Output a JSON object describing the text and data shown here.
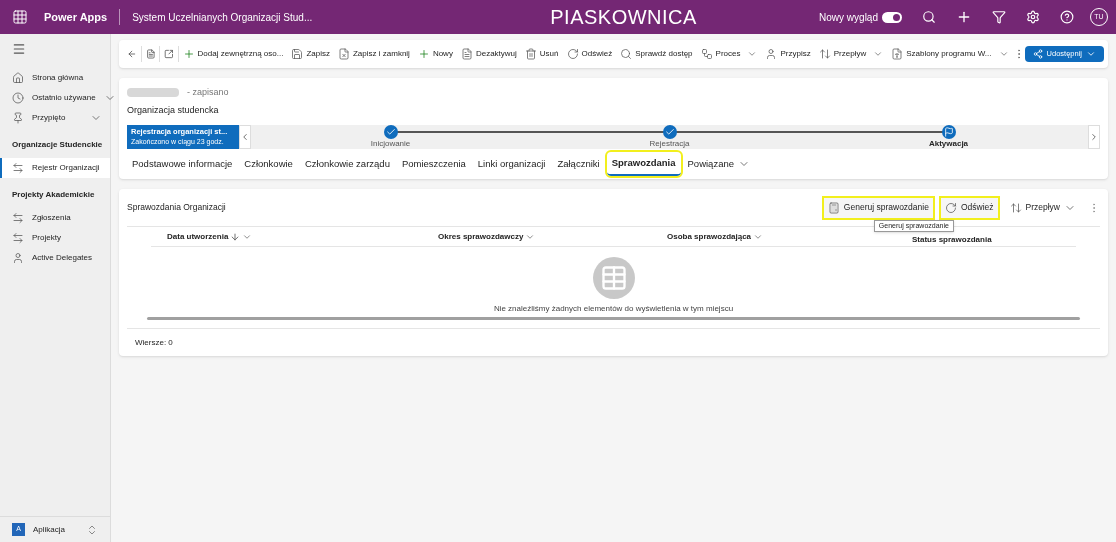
{
  "topbar": {
    "app": "Power Apps",
    "title": "System Uczelnianych Organizacji Stud...",
    "environment": "PIASKOWNICA",
    "new_look_label": "Nowy wygląd",
    "new_look_on": true,
    "avatar": "TU"
  },
  "sidebar": {
    "items": [
      {
        "kind": "item",
        "label": "Strona główna",
        "expandable": false,
        "selected": false
      },
      {
        "kind": "item",
        "label": "Ostatnio używane",
        "expandable": true,
        "selected": false
      },
      {
        "kind": "item",
        "label": "Przypięto",
        "expandable": true,
        "selected": false
      },
      {
        "kind": "group",
        "label": "Organizacje Studenckie"
      },
      {
        "kind": "item",
        "label": "Rejestr Organizacji",
        "expandable": false,
        "selected": true
      },
      {
        "kind": "group",
        "label": "Projekty Akademickie"
      },
      {
        "kind": "item",
        "label": "Zgłoszenia",
        "expandable": false,
        "selected": false
      },
      {
        "kind": "item",
        "label": "Projekty",
        "expandable": false,
        "selected": false
      },
      {
        "kind": "item",
        "label": "Active Delegates",
        "expandable": false,
        "selected": false
      }
    ],
    "area": {
      "badge": "A",
      "label": "Aplikacja"
    }
  },
  "commands": [
    {
      "label": "Dodaj zewnętrzną oso...",
      "dropdown": false
    },
    {
      "label": "Zapisz",
      "dropdown": false
    },
    {
      "label": "Zapisz i zamknij",
      "dropdown": false
    },
    {
      "label": "Nowy",
      "dropdown": false
    },
    {
      "label": "Dezaktywuj",
      "dropdown": false
    },
    {
      "label": "Usuń",
      "dropdown": false
    },
    {
      "label": "Odśwież",
      "dropdown": false
    },
    {
      "label": "Sprawdź dostęp",
      "dropdown": false
    },
    {
      "label": "Proces",
      "dropdown": true
    },
    {
      "label": "Przypisz",
      "dropdown": false
    },
    {
      "label": "Przepływ",
      "dropdown": true
    },
    {
      "label": "Szablony programu W...",
      "dropdown": true
    }
  ],
  "share_button": "Udostępnij",
  "record": {
    "status": "- zapisano",
    "entity": "Organizacja studencka"
  },
  "process": {
    "name": "Rejestracja organizacji st...",
    "duration": "Zakończono w ciągu 23 godz.",
    "stages": [
      {
        "label": "Inicjowanie",
        "done": true,
        "selected": false
      },
      {
        "label": "Rejestracja",
        "done": true,
        "selected": false
      },
      {
        "label": "Aktywacja",
        "selected": true
      }
    ]
  },
  "tabs": [
    {
      "label": "Podstawowe informacje",
      "selected": false,
      "highlighted": false,
      "dropdown": false
    },
    {
      "label": "Członkowie",
      "selected": false,
      "highlighted": false,
      "dropdown": false
    },
    {
      "label": "Członkowie zarządu",
      "selected": false,
      "highlighted": false,
      "dropdown": false
    },
    {
      "label": "Pomieszczenia",
      "selected": false,
      "highlighted": false,
      "dropdown": false
    },
    {
      "label": "Linki organizacji",
      "selected": false,
      "highlighted": false,
      "dropdown": false
    },
    {
      "label": "Załączniki",
      "selected": false,
      "highlighted": false,
      "dropdown": false
    },
    {
      "label": "Sprawozdania",
      "selected": true,
      "highlighted": true,
      "dropdown": false
    },
    {
      "label": "Powiązane",
      "selected": false,
      "highlighted": false,
      "dropdown": true
    }
  ],
  "grid": {
    "title": "Sprawozdania Organizacji",
    "actions": [
      {
        "label": "Generuj sprawozdanie",
        "dropdown": false,
        "highlighted": true
      },
      {
        "label": "Odśwież",
        "dropdown": false,
        "highlighted": true
      },
      {
        "label": "Przepływ",
        "dropdown": true,
        "highlighted": false
      }
    ],
    "tooltip": "Generuj sprawozdanie",
    "columns": [
      {
        "label": "Data utworzenia",
        "sorted": true
      },
      {
        "label": "Okres sprawozdawczy",
        "sorted": false
      },
      {
        "label": "Osoba sprawozdająca",
        "sorted": false
      },
      {
        "label": "Status sprawozdania",
        "sorted": false
      }
    ],
    "empty_message": "Nie znaleźliśmy żadnych elementów do wyświetlenia w tym miejscu",
    "row_count": "Wiersze: 0"
  }
}
